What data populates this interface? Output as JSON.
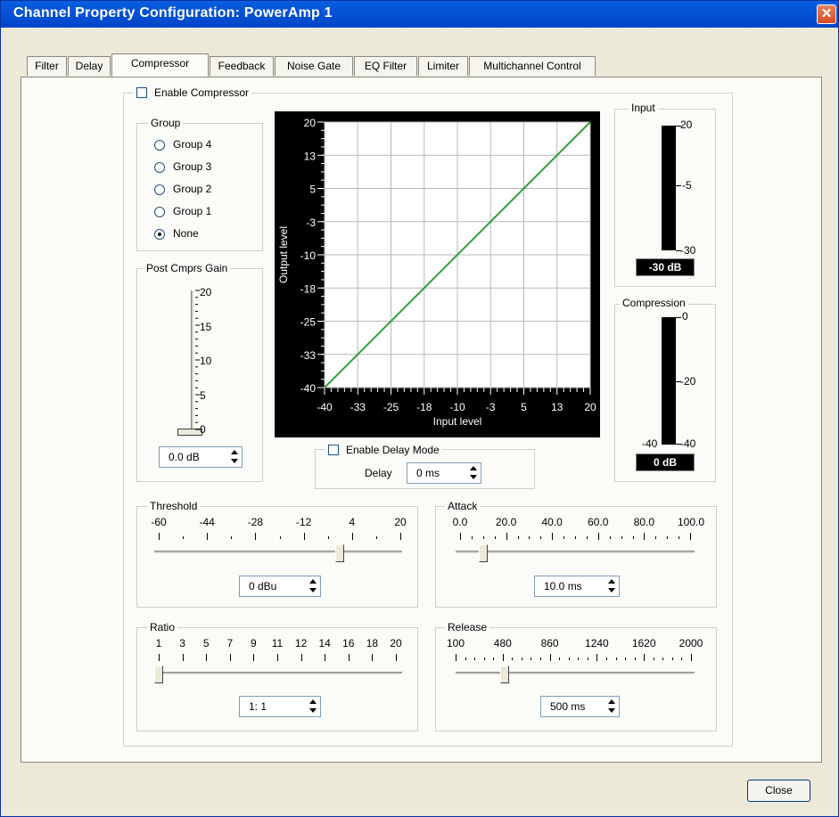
{
  "window": {
    "title": "Channel Property Configuration: PowerAmp 1",
    "close_glyph": "✕"
  },
  "tabs": [
    "Filter",
    "Delay",
    "Compressor",
    "Feedback",
    "Noise Gate",
    "EQ Filter",
    "Limiter",
    "Multichannel Control"
  ],
  "active_tab": "Compressor",
  "enable_compressor": {
    "label": "Enable Compressor",
    "checked": false
  },
  "group": {
    "title": "Group",
    "options": [
      "Group 4",
      "Group 3",
      "Group 2",
      "Group 1",
      "None"
    ],
    "selected": "None"
  },
  "post_gain": {
    "title": "Post Cmprs Gain",
    "scale": [
      "20",
      "15",
      "10",
      "5",
      "0"
    ],
    "value": "0.0 dB"
  },
  "graph": {
    "ylabel": "Output level",
    "xlabel": "Input level",
    "yticks": [
      "20",
      "13",
      "5",
      "-3",
      "-10",
      "-18",
      "-25",
      "-33",
      "-40"
    ],
    "xticks": [
      "-40",
      "-33",
      "-25",
      "-18",
      "-10",
      "-3",
      "5",
      "13",
      "20"
    ],
    "line_color": "#2e9e2e"
  },
  "delay_mode": {
    "label": "Enable Delay Mode",
    "checked": false,
    "delay_label": "Delay",
    "delay_value": "0 ms"
  },
  "input_meter": {
    "title": "Input",
    "top": "20",
    "mid": "-5",
    "bottom": "-30",
    "readout": "-30 dB"
  },
  "compression_meter": {
    "title": "Compression",
    "top": "0",
    "mid": "-20",
    "bottom_left": "-40",
    "bottom_right": "-40",
    "readout": "0 dB"
  },
  "threshold": {
    "title": "Threshold",
    "scale": [
      "-60",
      "-44",
      "-28",
      "-12",
      "4",
      "20"
    ],
    "value": "0 dBu",
    "position": 0.75
  },
  "attack": {
    "title": "Attack",
    "scale": [
      "0.0",
      "20.0",
      "40.0",
      "60.0",
      "80.0",
      "100.0"
    ],
    "value": "10.0 ms",
    "position": 0.1
  },
  "ratio": {
    "title": "Ratio",
    "scale": [
      "1",
      "3",
      "5",
      "7",
      "9",
      "11",
      "12",
      "14",
      "16",
      "18",
      "20"
    ],
    "value": "1: 1",
    "position": 0.0
  },
  "release": {
    "title": "Release",
    "scale": [
      "100",
      "480",
      "860",
      "1240",
      "1620",
      "2000"
    ],
    "value": "500 ms",
    "position": 0.21
  },
  "footer": {
    "close_label": "Close"
  }
}
